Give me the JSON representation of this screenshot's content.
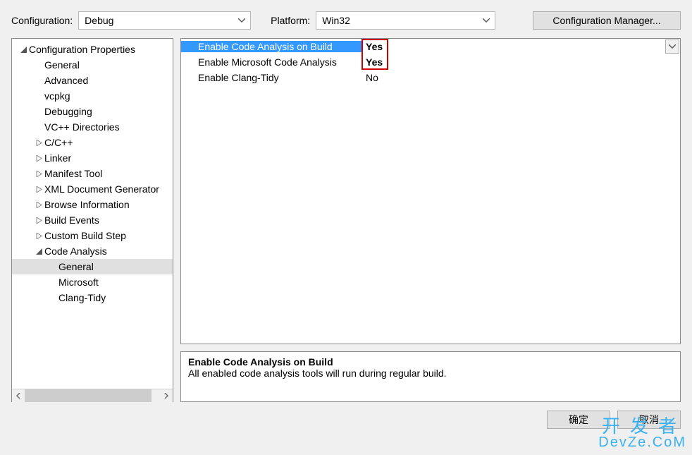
{
  "toolbar": {
    "configuration_label": "Configuration:",
    "configuration_value": "Debug",
    "platform_label": "Platform:",
    "platform_value": "Win32",
    "config_manager_label": "Configuration Manager..."
  },
  "tree": {
    "root": "Configuration Properties",
    "items": [
      {
        "label": "General",
        "depth": 1,
        "expander": "none"
      },
      {
        "label": "Advanced",
        "depth": 1,
        "expander": "none"
      },
      {
        "label": "vcpkg",
        "depth": 1,
        "expander": "none"
      },
      {
        "label": "Debugging",
        "depth": 1,
        "expander": "none"
      },
      {
        "label": "VC++ Directories",
        "depth": 1,
        "expander": "none"
      },
      {
        "label": "C/C++",
        "depth": 1,
        "expander": "closed"
      },
      {
        "label": "Linker",
        "depth": 1,
        "expander": "closed"
      },
      {
        "label": "Manifest Tool",
        "depth": 1,
        "expander": "closed"
      },
      {
        "label": "XML Document Generator",
        "depth": 1,
        "expander": "closed"
      },
      {
        "label": "Browse Information",
        "depth": 1,
        "expander": "closed"
      },
      {
        "label": "Build Events",
        "depth": 1,
        "expander": "closed"
      },
      {
        "label": "Custom Build Step",
        "depth": 1,
        "expander": "closed"
      },
      {
        "label": "Code Analysis",
        "depth": 1,
        "expander": "open"
      },
      {
        "label": "General",
        "depth": 2,
        "expander": "none",
        "selected": true
      },
      {
        "label": "Microsoft",
        "depth": 2,
        "expander": "none"
      },
      {
        "label": "Clang-Tidy",
        "depth": 2,
        "expander": "none"
      }
    ]
  },
  "grid": {
    "rows": [
      {
        "name": "Enable Code Analysis on Build",
        "value": "Yes",
        "selected": true,
        "bold": true,
        "dropdown": true
      },
      {
        "name": "Enable Microsoft Code Analysis",
        "value": "Yes",
        "bold": true
      },
      {
        "name": "Enable Clang-Tidy",
        "value": "No"
      }
    ]
  },
  "description": {
    "title": "Enable Code Analysis on Build",
    "body": "All enabled code analysis tools will run during regular build."
  },
  "buttons": {
    "ok": "确定",
    "cancel": "取消"
  },
  "watermark": {
    "line1": "开发者",
    "line2": "DevZe.CoM"
  }
}
